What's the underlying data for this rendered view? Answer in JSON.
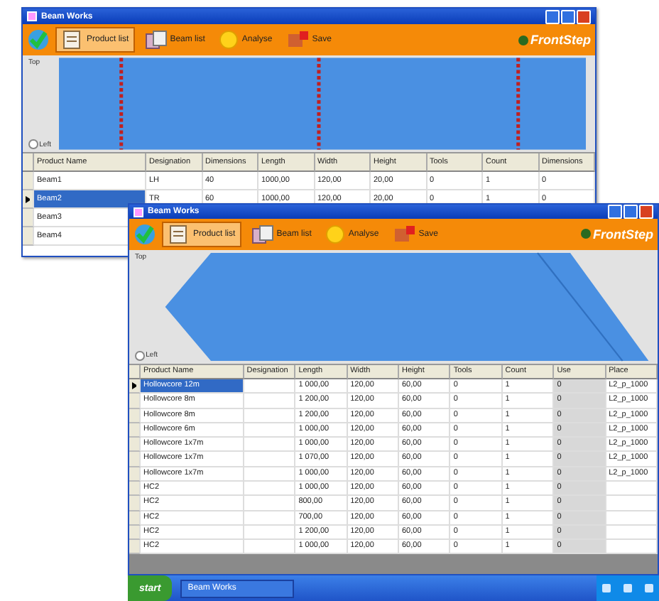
{
  "windows": [
    {
      "title": "Beam Works",
      "logo": "FrontStep",
      "toolbar": [
        {
          "label": "Product list",
          "selected": true
        },
        {
          "label": "Beam list",
          "selected": false
        },
        {
          "label": "Analyse",
          "selected": false
        },
        {
          "label": "Save",
          "selected": false
        }
      ],
      "canvas": {
        "kind": "beams",
        "top_label": "Top",
        "side_label": "Left",
        "side_selected": false
      },
      "table": {
        "columns": [
          "Product Name",
          "Designation",
          "Dimensions",
          "Length",
          "Width",
          "Height",
          "Tools",
          "Count",
          "Dimensions"
        ],
        "rows": [
          {
            "cells": [
              "Beam1",
              "LH",
              "40",
              "1000,00",
              "120,00",
              "20,00",
              "0",
              "1",
              "0"
            ],
            "selected": false
          },
          {
            "cells": [
              "Beam2",
              "TR",
              "60",
              "1000,00",
              "120,00",
              "20,00",
              "0",
              "1",
              "0"
            ],
            "selected": true
          },
          {
            "cells": [
              "Beam3",
              "",
              "",
              "",
              "",
              "",
              "",
              "",
              ""
            ],
            "selected": false
          },
          {
            "cells": [
              "Beam4",
              "",
              "",
              "",
              "",
              "",
              "",
              "",
              ""
            ],
            "selected": false
          }
        ]
      }
    },
    {
      "title": "Beam Works",
      "logo": "FrontStep",
      "toolbar": [
        {
          "label": "Product list",
          "selected": true
        },
        {
          "label": "Beam list",
          "selected": false
        },
        {
          "label": "Analyse",
          "selected": false
        },
        {
          "label": "Save",
          "selected": false
        }
      ],
      "canvas": {
        "kind": "slab",
        "top_label": "Top",
        "side_label": "Left",
        "side_selected": false
      },
      "table": {
        "columns": [
          "Product Name",
          "Designation",
          "Length",
          "Width",
          "Height",
          "Tools",
          "Count",
          "Use",
          "Place"
        ],
        "rows": [
          {
            "cells": [
              "Hollowcore 12m",
              "",
              "1 000,00",
              "120,00",
              "60,00",
              "0",
              "1",
              "0",
              "L2_p_1000"
            ],
            "selected": true
          },
          {
            "cells": [
              "Hollowcore 8m",
              "",
              "1 200,00",
              "120,00",
              "60,00",
              "0",
              "1",
              "0",
              "L2_p_1000"
            ],
            "selected": false
          },
          {
            "cells": [
              "Hollowcore 8m",
              "",
              "1 200,00",
              "120,00",
              "60,00",
              "0",
              "1",
              "0",
              "L2_p_1000"
            ],
            "selected": false
          },
          {
            "cells": [
              "Hollowcore 6m",
              "",
              "1 000,00",
              "120,00",
              "60,00",
              "0",
              "1",
              "0",
              "L2_p_1000"
            ],
            "selected": false
          },
          {
            "cells": [
              "Hollowcore 1x7m",
              "",
              "1 000,00",
              "120,00",
              "60,00",
              "0",
              "1",
              "0",
              "L2_p_1000"
            ],
            "selected": false
          },
          {
            "cells": [
              "Hollowcore 1x7m",
              "",
              "1 070,00",
              "120,00",
              "60,00",
              "0",
              "1",
              "0",
              "L2_p_1000"
            ],
            "selected": false
          },
          {
            "cells": [
              "Hollowcore 1x7m",
              "",
              "1 000,00",
              "120,00",
              "60,00",
              "0",
              "1",
              "0",
              "L2_p_1000"
            ],
            "selected": false
          },
          {
            "cells": [
              "HC2",
              "",
              "1 000,00",
              "120,00",
              "60,00",
              "0",
              "1",
              "0",
              ""
            ],
            "selected": false
          },
          {
            "cells": [
              "HC2",
              "",
              "800,00",
              "120,00",
              "60,00",
              "0",
              "1",
              "0",
              ""
            ],
            "selected": false
          },
          {
            "cells": [
              "HC2",
              "",
              "700,00",
              "120,00",
              "60,00",
              "0",
              "1",
              "0",
              ""
            ],
            "selected": false
          },
          {
            "cells": [
              "HC2",
              "",
              "1 200,00",
              "120,00",
              "60,00",
              "0",
              "1",
              "0",
              ""
            ],
            "selected": false
          },
          {
            "cells": [
              "HC2",
              "",
              "1 000,00",
              "120,00",
              "60,00",
              "0",
              "1",
              "0",
              ""
            ],
            "selected": false
          }
        ]
      }
    }
  ],
  "taskbar": {
    "start": "start",
    "tasks": [
      {
        "label": "Beam Works"
      }
    ]
  }
}
